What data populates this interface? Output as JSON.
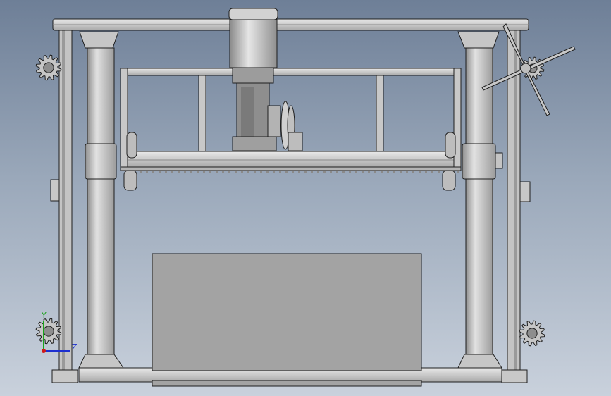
{
  "viewport": {
    "background_top": "#6e7f97",
    "background_bottom": "#c9d1dc",
    "part_fill": "#c8c8c8",
    "part_shade": "#9a9a9a",
    "part_edge": "#1e1e1e",
    "block_fill": "#a3a3a3"
  },
  "triad": {
    "x_label": "X",
    "y_label": "Y",
    "z_label": "Z",
    "x_color": "#d01a1a",
    "y_color": "#19a319",
    "z_color": "#1c2fd0"
  },
  "icons": [
    "gear-icon",
    "handwheel-icon",
    "motor-icon",
    "pulley-icon"
  ]
}
